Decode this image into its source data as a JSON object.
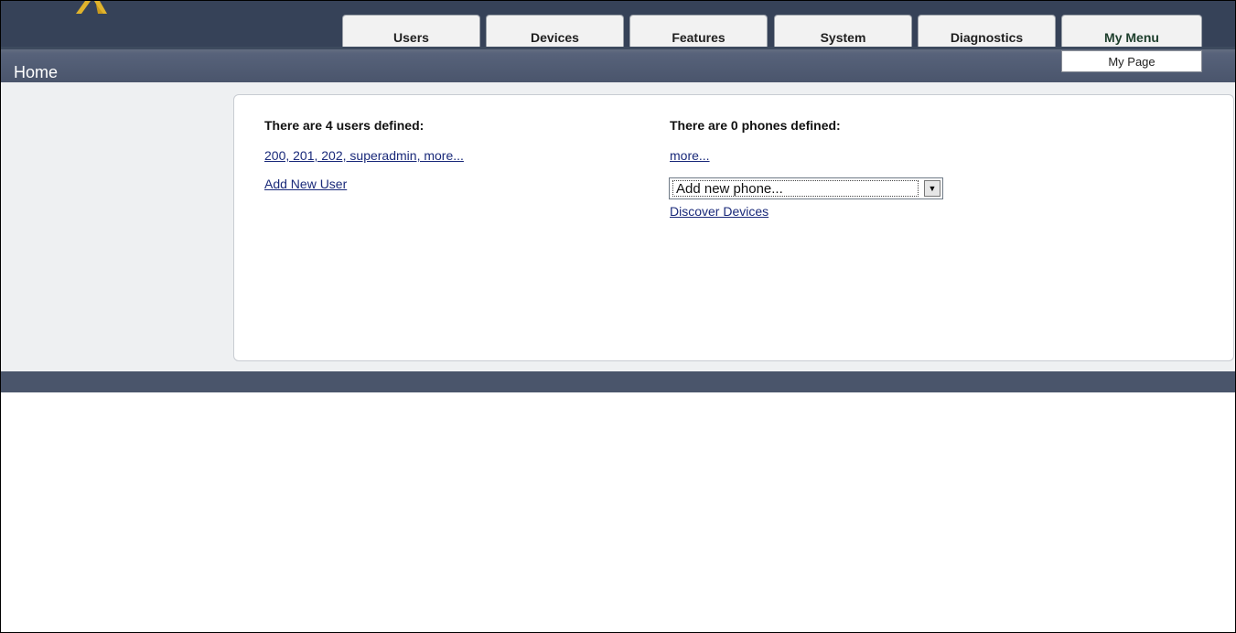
{
  "tabs": [
    {
      "label": "Users"
    },
    {
      "label": "Devices"
    },
    {
      "label": "Features"
    },
    {
      "label": "System"
    },
    {
      "label": "Diagnostics"
    },
    {
      "label": "My Menu"
    }
  ],
  "dropdown": {
    "item": "My Page"
  },
  "breadcrumb": "Home",
  "users": {
    "heading": "There are 4 users defined:",
    "list_link": "200, 201, 202, superadmin, more...",
    "add_link": "Add New User"
  },
  "phones": {
    "heading": "There are 0 phones defined:",
    "more_link": "more...",
    "select_value": "Add new phone...",
    "discover_link": "Discover Devices"
  },
  "colors": {
    "header": "#364258",
    "subbar": "#4a556c",
    "link": "#1a2a7a",
    "logo": "#e0b32c"
  },
  "icons": {
    "logo": "logo-icon",
    "select_arrow": "chevron-down-icon"
  }
}
